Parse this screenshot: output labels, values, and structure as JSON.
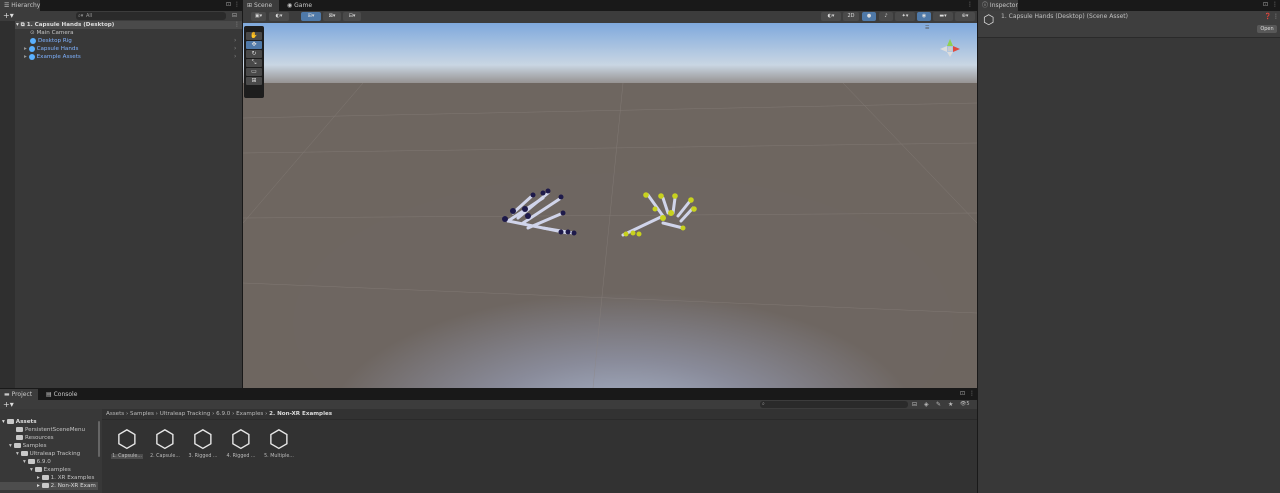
{
  "hierarchy": {
    "tab": "Hierarchy",
    "search_value": "All",
    "rows": [
      {
        "label": "1. Capsule Hands (Desktop)",
        "kind": "scene"
      },
      {
        "label": "Main Camera",
        "kind": "camera"
      },
      {
        "label": "Desktop Rig",
        "kind": "prefab"
      },
      {
        "label": "Capsule Hands",
        "kind": "prefab"
      },
      {
        "label": "Example Assets",
        "kind": "prefab"
      }
    ]
  },
  "scene": {
    "tabs": [
      "Scene",
      "Game"
    ],
    "mode_2d": "2D"
  },
  "inspector": {
    "tab": "Inspector",
    "title": "1. Capsule Hands (Desktop) (Scene Asset)",
    "open_button": "Open"
  },
  "project": {
    "tabs": [
      "Project",
      "Console"
    ],
    "breadcrumb": [
      "Assets",
      "Samples",
      "Ultraleap Tracking",
      "6.9.0",
      "Examples",
      "2. Non-XR Examples"
    ],
    "tree": [
      {
        "label": "Assets",
        "depth": 0,
        "bold": true
      },
      {
        "label": "PersistentSceneMenu",
        "depth": 1
      },
      {
        "label": "Resources",
        "depth": 1
      },
      {
        "label": "Samples",
        "depth": 1
      },
      {
        "label": "Ultraleap Tracking",
        "depth": 2
      },
      {
        "label": "6.9.0",
        "depth": 3
      },
      {
        "label": "Examples",
        "depth": 4
      },
      {
        "label": "1. XR Examples",
        "depth": 5
      },
      {
        "label": "2. Non-XR Exam",
        "depth": 5,
        "selected": true
      }
    ],
    "assets": [
      "1. Capsule...",
      "2. Capsule...",
      "3. Rigged ...",
      "4. Rigged ...",
      "5. Multiple..."
    ],
    "hidden_count": "5"
  },
  "colors": {
    "accent": "#4f79a8",
    "left_hand": "#1e1a4a",
    "right_hand": "#c8d21e"
  }
}
